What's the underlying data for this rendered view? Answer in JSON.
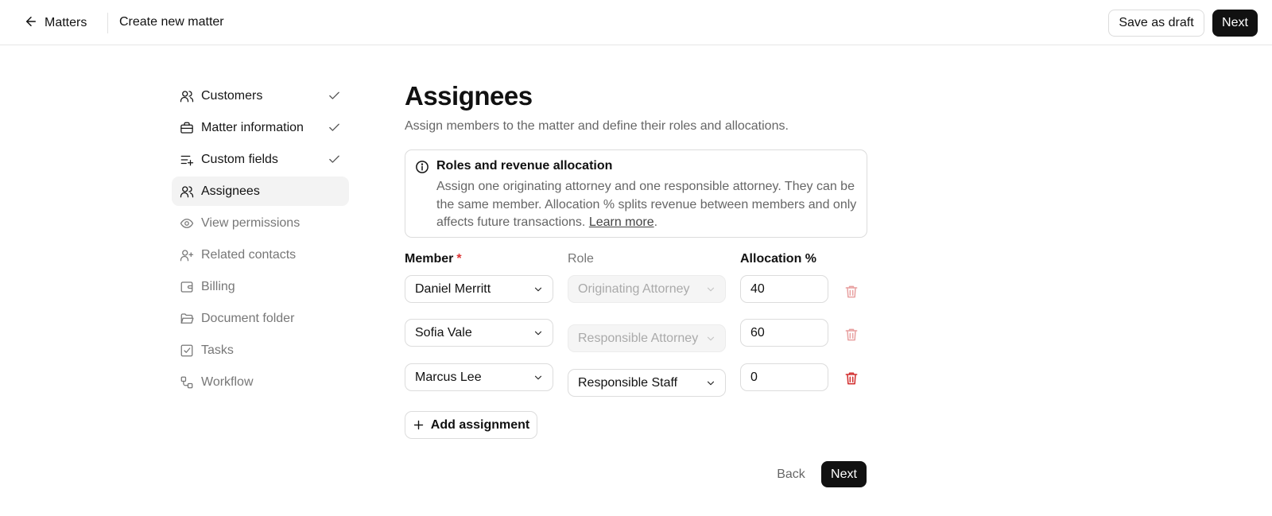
{
  "header": {
    "back_label": "Matters",
    "title": "Create new matter",
    "save_draft_label": "Save as draft",
    "next_label": "Next"
  },
  "sidebar": {
    "steps": [
      {
        "label": "Customers",
        "icon": "users-icon",
        "status": "done"
      },
      {
        "label": "Matter information",
        "icon": "briefcase-icon",
        "status": "done"
      },
      {
        "label": "Custom fields",
        "icon": "list-plus-icon",
        "status": "done"
      },
      {
        "label": "Assignees",
        "icon": "users-icon",
        "status": "active"
      },
      {
        "label": "View permissions",
        "icon": "eye-icon",
        "status": "pending"
      },
      {
        "label": "Related contacts",
        "icon": "user-plus-icon",
        "status": "pending"
      },
      {
        "label": "Billing",
        "icon": "wallet-icon",
        "status": "pending"
      },
      {
        "label": "Document folder",
        "icon": "folder-icon",
        "status": "pending"
      },
      {
        "label": "Tasks",
        "icon": "checkbox-icon",
        "status": "pending"
      },
      {
        "label": "Workflow",
        "icon": "workflow-icon",
        "status": "pending"
      }
    ]
  },
  "main": {
    "title": "Assignees",
    "subtitle": "Assign members to the matter and define their roles and allocations.",
    "info": {
      "title": "Roles and revenue allocation",
      "body": "Assign one originating attorney and one responsible attorney. They can be the same member. Allocation % splits revenue between members and only affects future transactions.",
      "link": "Learn more",
      "after_link": "."
    },
    "columns": {
      "member": "Member",
      "required_marker": "*",
      "role": "Role",
      "allocation": "Allocation %"
    },
    "rows": [
      {
        "member": "Daniel Merritt",
        "role": "Originating Attorney",
        "role_disabled": true,
        "allocation": "40"
      },
      {
        "member": "Sofia Vale",
        "role": "Responsible Attorney",
        "role_disabled": true,
        "allocation": "60"
      },
      {
        "member": "Marcus Lee",
        "role": "Responsible Staff",
        "role_disabled": false,
        "allocation": "0"
      }
    ],
    "add_label": "Add assignment",
    "back_label": "Back",
    "next_label": "Next"
  },
  "colors": {
    "primary": "#111111",
    "muted_text": "#666666",
    "danger": "#d33333",
    "danger_muted": "#e8a0a0",
    "active_bg": "#f3f3f3"
  }
}
